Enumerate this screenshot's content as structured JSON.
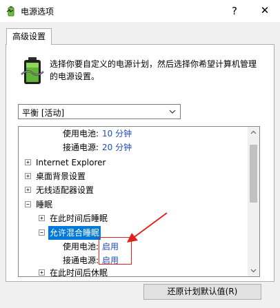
{
  "window": {
    "title": "电源选项",
    "help_glyph": "?",
    "close_glyph": "✕"
  },
  "tabs": [
    {
      "label": "高级设置"
    }
  ],
  "description": {
    "line1": "选择你要自定义的电源计划，然后选择你希望计算机管理",
    "line2": "的电源设置。"
  },
  "plan_select": {
    "value": "平衡 [活动]"
  },
  "tree": {
    "items": [
      {
        "label": "使用电池:",
        "value": "10 分钟"
      },
      {
        "label": "接通电源:",
        "value": "20 分钟"
      },
      {
        "label": "Internet Explorer"
      },
      {
        "label": "桌面背景设置"
      },
      {
        "label": "无线适配器设置"
      },
      {
        "label": "睡眠"
      },
      {
        "label": "在此时间后睡眠"
      },
      {
        "label": "允许混合睡眠"
      },
      {
        "label": "使用电池:",
        "value": "启用"
      },
      {
        "label": "接通电源:",
        "value": "启用"
      },
      {
        "label": "在此时间后休眠"
      }
    ]
  },
  "buttons": {
    "restore_defaults": "还原计划默认值(R)"
  },
  "colors": {
    "selection": "#0078d7",
    "value_text": "#1f4bb8",
    "annotation": "#e0221b"
  }
}
